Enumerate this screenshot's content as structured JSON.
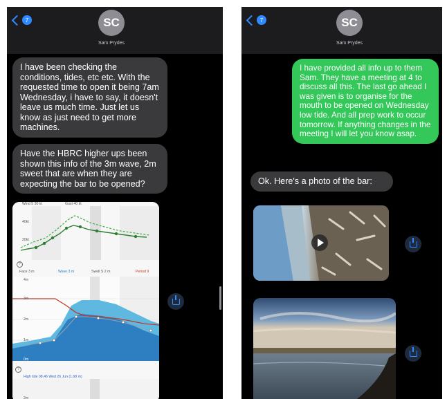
{
  "left_phone": {
    "back_badge": "7",
    "avatar_initials": "SC",
    "contact_name": "Sam Prydes",
    "messages": [
      {
        "from": "received",
        "text": "I have been checking the conditions, tides, etc etc. With the requested time to open it being 7am Wednesday, i have to say, it doesn't leave us much time. Just let us know as just need to get more machines."
      },
      {
        "from": "received",
        "text": "Have the HBRC higher ups been shown this info of the 3m wave, 2m sweet that are when they are expecting the bar to be opened?"
      }
    ],
    "forecast_image": {
      "wind_labels": [
        "Wind 5 30 kt",
        "Gust 40 kt"
      ],
      "wind_axis": [
        "40kt",
        "20kt"
      ],
      "help_glyph": "?",
      "legend": [
        "Face 3 m",
        "Wave 3 m",
        "Swell S 2 m",
        "Period 9"
      ],
      "wave_axis": [
        "4m",
        "3m",
        "2m",
        "1m",
        "0m"
      ],
      "tide_caption": "High tide 08.46 Wed 26 Jun (1.68 m)",
      "tide_axis": "2m"
    }
  },
  "right_phone": {
    "back_badge": "7",
    "avatar_initials": "SC",
    "contact_name": "Sam Prydes",
    "messages": [
      {
        "from": "sent",
        "text": "I have provided all info up to them Sam. They have a meeting at 4 to discuss all this. The last go ahead I was given is to organise for the mouth to be opened on Wednesday low tide. And all prep work to occur tomorrow. If anything changes in the meeting I will let you know asap."
      },
      {
        "from": "received",
        "text": "Ok. Here's a photo of the bar:"
      }
    ]
  },
  "colors": {
    "sent_bubble": "#34c759",
    "received_bubble": "#3a3a3c",
    "accent": "#2f8bff",
    "background": "#000000"
  },
  "icons": [
    "chevron-left-icon",
    "save-icon",
    "play-icon",
    "help-icon"
  ]
}
